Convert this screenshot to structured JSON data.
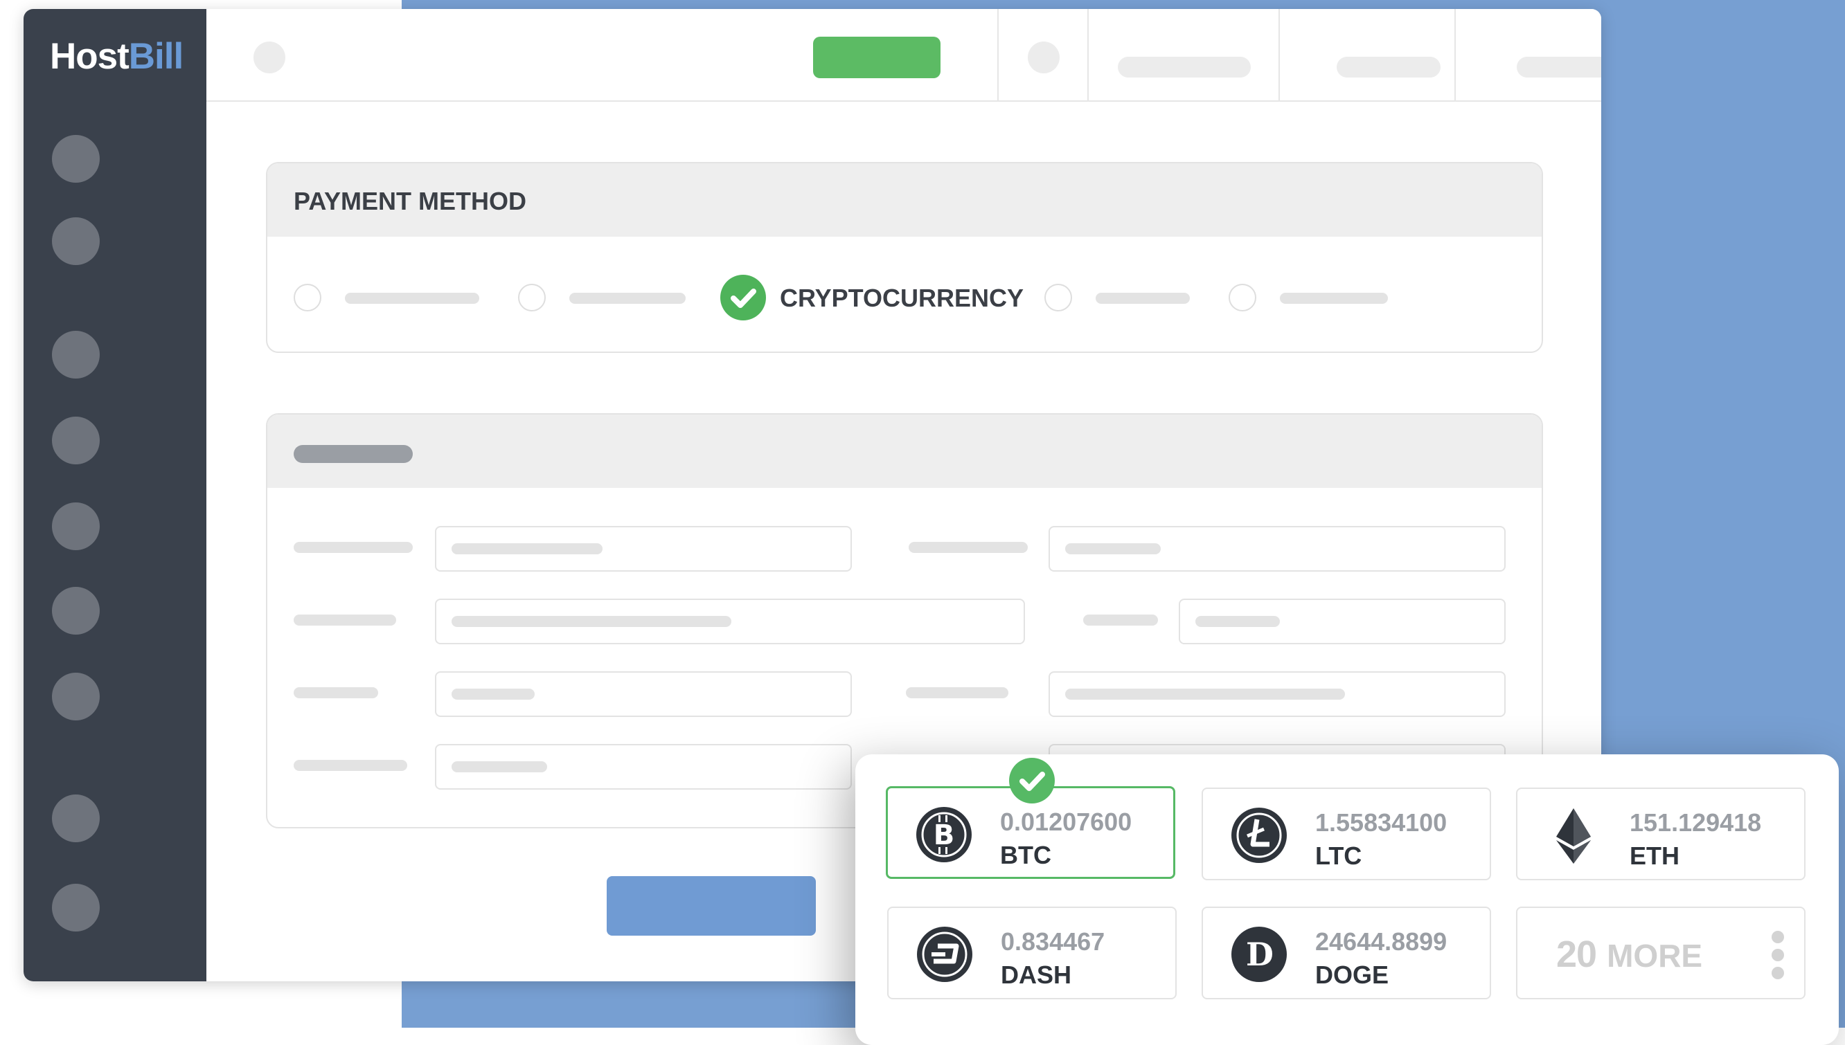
{
  "app": {
    "logo_main": "Host",
    "logo_accent": "Bill"
  },
  "colors": {
    "accent_blue": "#779fd2",
    "success_green": "#5cbb64",
    "sidebar_bg": "#3a414c"
  },
  "payment": {
    "title": "PAYMENT METHOD",
    "selected_option": "CRYPTOCURRENCY"
  },
  "crypto": {
    "coins": [
      {
        "amount": "0.01207600",
        "symbol": "BTC",
        "icon": "bitcoin-icon",
        "selected": true
      },
      {
        "amount": "1.55834100",
        "symbol": "LTC",
        "icon": "litecoin-icon",
        "selected": false
      },
      {
        "amount": "151.129418",
        "symbol": "ETH",
        "icon": "ethereum-icon",
        "selected": false
      },
      {
        "amount": "0.834467",
        "symbol": "DASH",
        "icon": "dash-icon",
        "selected": false
      },
      {
        "amount": "24644.8899",
        "symbol": "DOGE",
        "icon": "dogecoin-icon",
        "selected": false
      }
    ],
    "more_count": "20",
    "more_label": "MORE"
  }
}
